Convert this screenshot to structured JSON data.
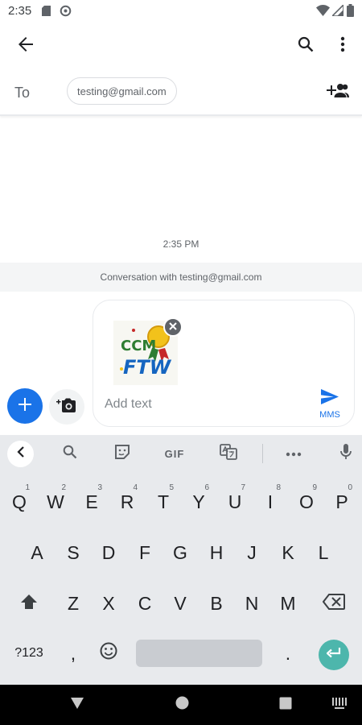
{
  "status_bar": {
    "time": "2:35"
  },
  "to_row": {
    "label": "To",
    "recipient_chip": "testing@gmail.com"
  },
  "conversation": {
    "timestamp": "2:35 PM",
    "banner": "Conversation with testing@gmail.com"
  },
  "compose": {
    "placeholder": "Add text",
    "send_label": "MMS",
    "attachment_text": {
      "line1": "CCM",
      "line2": "FTW"
    }
  },
  "keyboard": {
    "toolbar_gif": "GIF",
    "row1": [
      {
        "k": "Q",
        "h": "1"
      },
      {
        "k": "W",
        "h": "2"
      },
      {
        "k": "E",
        "h": "3"
      },
      {
        "k": "R",
        "h": "4"
      },
      {
        "k": "T",
        "h": "5"
      },
      {
        "k": "Y",
        "h": "6"
      },
      {
        "k": "U",
        "h": "7"
      },
      {
        "k": "I",
        "h": "8"
      },
      {
        "k": "O",
        "h": "9"
      },
      {
        "k": "P",
        "h": "0"
      }
    ],
    "row2": [
      "A",
      "S",
      "D",
      "F",
      "G",
      "H",
      "J",
      "K",
      "L"
    ],
    "row3": [
      "Z",
      "X",
      "C",
      "V",
      "B",
      "N",
      "M"
    ],
    "symbols_key": "?123",
    "comma_key": ",",
    "period_key": "."
  },
  "colors": {
    "accent_blue": "#1a73e8",
    "enter_teal": "#4db6ac",
    "keyboard_bg": "#e8eaed"
  },
  "icons": {
    "back": "arrow-left-icon",
    "search": "search-icon",
    "more": "more-vert-icon",
    "add_people": "add-people-icon",
    "add": "plus-icon",
    "camera": "camera-icon",
    "send": "send-icon"
  }
}
